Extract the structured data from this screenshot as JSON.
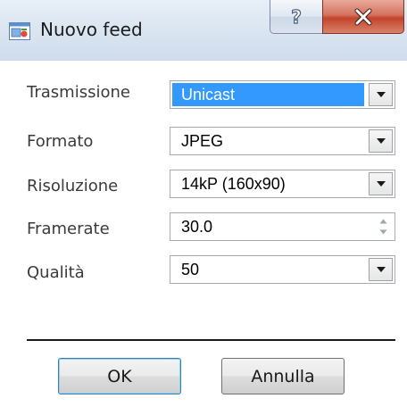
{
  "window": {
    "title": "Nuovo feed",
    "icon": "app-window-icon",
    "help_label": "?",
    "close_label": "x"
  },
  "form": {
    "rows": [
      {
        "label": "Trasmissione",
        "value": "Unicast",
        "control": "select",
        "selected": true
      },
      {
        "label": "Formato",
        "value": "JPEG",
        "control": "select"
      },
      {
        "label": "Risoluzione",
        "value": "14kP (160x90)",
        "control": "select"
      },
      {
        "label": "Framerate",
        "value": "30.0",
        "control": "spinbox"
      },
      {
        "label": "Qualità",
        "value": "50",
        "control": "select"
      }
    ]
  },
  "buttons": {
    "ok_label": "OK",
    "cancel_label": "Annulla"
  },
  "colors": {
    "selection": "#3399ff",
    "close_button": "#c3432b",
    "default_button_border": "#3c7fb1"
  }
}
